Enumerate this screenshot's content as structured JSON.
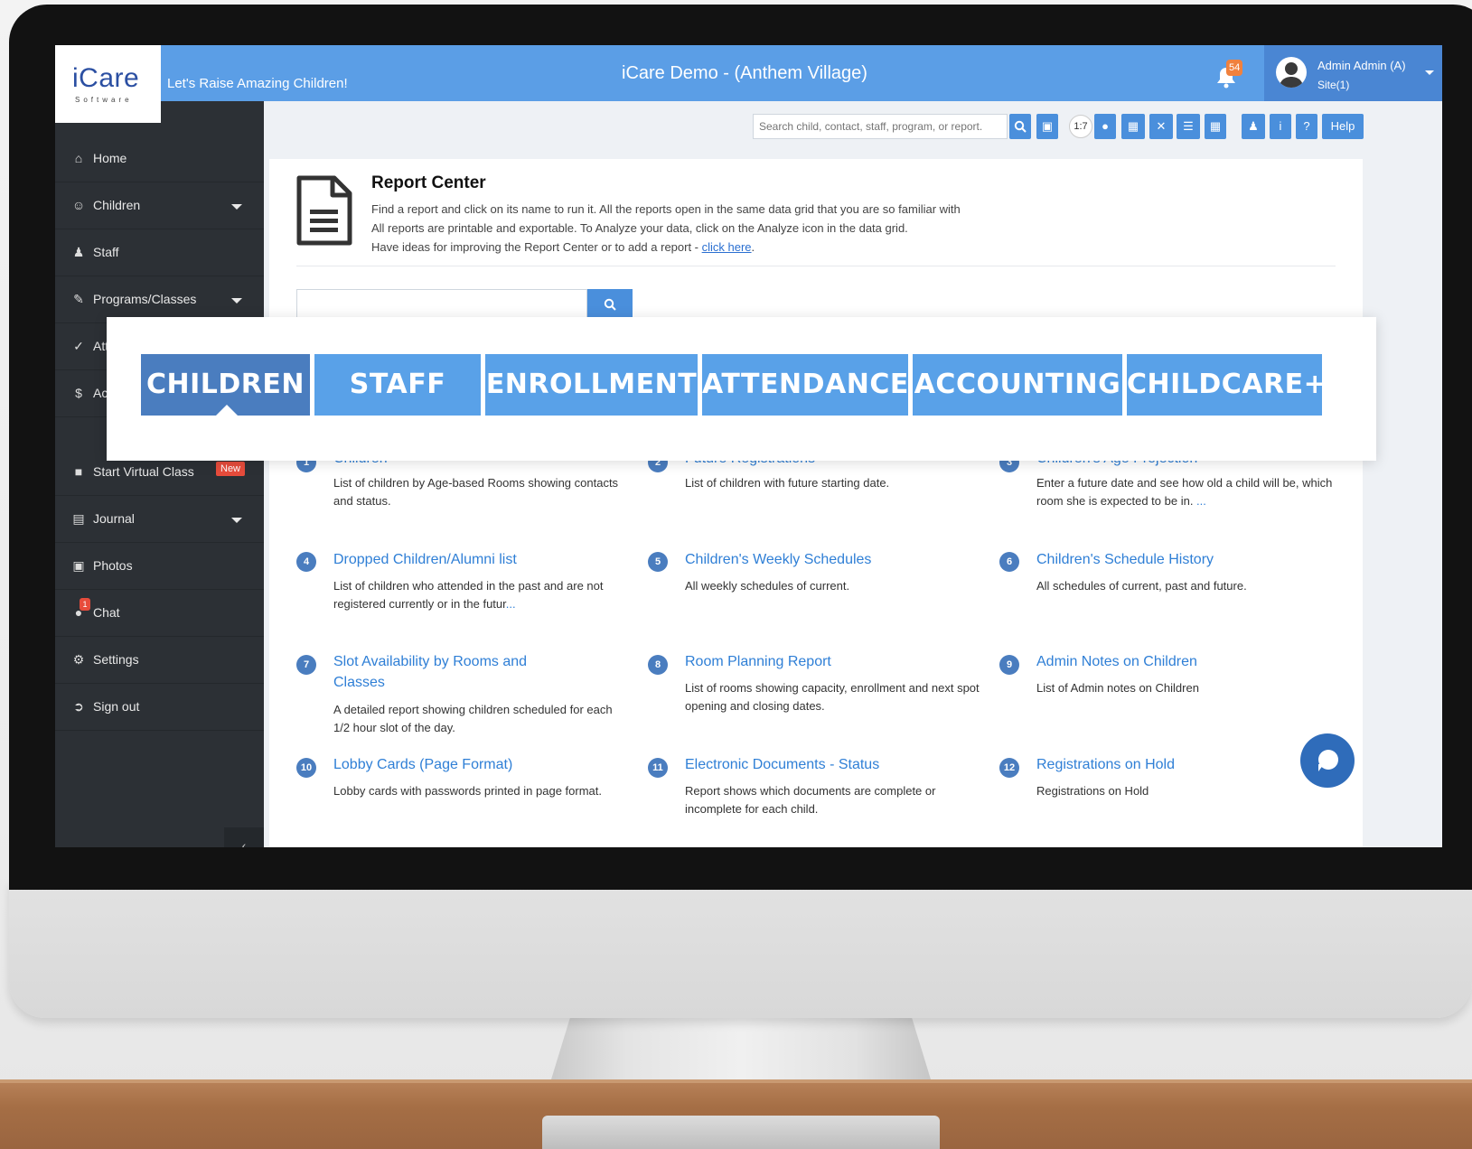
{
  "app": {
    "logo_text": "iCare",
    "logo_sub": "Software",
    "tagline": "Let's Raise Amazing Children!",
    "title": "iCare Demo - (Anthem Village)",
    "notification_count": "54",
    "user_name": "Admin Admin (A)",
    "user_site": "Site(1)"
  },
  "sidebar": {
    "items": [
      {
        "label": "Home",
        "icon": "home-icon"
      },
      {
        "label": "Children",
        "icon": "smile-icon"
      },
      {
        "label": "Staff",
        "icon": "user-icon"
      },
      {
        "label": "Programs/Classes",
        "icon": "pencil-icon"
      },
      {
        "label": "Att",
        "icon": "check-circle-icon"
      },
      {
        "label": "Ac",
        "icon": "dollar-icon"
      },
      {
        "label": "Start Virtual Class",
        "icon": "video-icon",
        "badge": "New"
      },
      {
        "label": "Journal",
        "icon": "chart-icon"
      },
      {
        "label": "Photos",
        "icon": "camera-icon"
      },
      {
        "label": "Chat",
        "icon": "chat-icon",
        "badge": "1"
      },
      {
        "label": "Settings",
        "icon": "gear-icon"
      },
      {
        "label": "Sign out",
        "icon": "sign-out-icon"
      }
    ],
    "collapse_label": "‹"
  },
  "toolbar": {
    "search_placeholder": "Search child, contact, staff, program, or report.",
    "ratio_label": "1:7",
    "info_label": "i",
    "question_label": "?",
    "help_label": "Help"
  },
  "report_center": {
    "title": "Report Center",
    "line1": "Find a report and click on its name to run it. All the reports open in the same data grid that you are so familiar with",
    "line2": "All reports are printable and exportable. To Analyze your data, click on the Analyze icon in the data grid.",
    "line3": "Have ideas for improving the Report Center or to add a report - ",
    "link_text": "click here",
    "link_suffix": "."
  },
  "categories": [
    "CHILDREN",
    "STAFF",
    "ENROLLMENT",
    "ATTENDANCE",
    "ACCOUNTING",
    "CHILDCARE+"
  ],
  "reports": [
    {
      "num": "1",
      "title": "Children",
      "desc": "List of children by Age-based Rooms showing contacts and status."
    },
    {
      "num": "2",
      "title": "Future Registrations",
      "desc": "List of children with future starting date."
    },
    {
      "num": "3",
      "title": "Children's Age Projection",
      "desc": "Enter a future date and see how old a child will be, which room she is expected to be in.",
      "more": " ..."
    },
    {
      "num": "4",
      "title": "Dropped Children/Alumni list",
      "desc": "List of children who attended in the past and are not registered currently or in the futur",
      "more": "..."
    },
    {
      "num": "5",
      "title": "Children's Weekly Schedules",
      "desc": "All weekly schedules of current."
    },
    {
      "num": "6",
      "title": "Children's Schedule History",
      "desc": "All schedules of current, past and future."
    },
    {
      "num": "7",
      "title": "Slot Availability by Rooms and Classes",
      "desc": "A detailed report showing children scheduled for each 1/2 hour slot of the day."
    },
    {
      "num": "8",
      "title": "Room Planning Report",
      "desc": "List of rooms showing capacity, enrollment and next spot opening and closing dates."
    },
    {
      "num": "9",
      "title": "Admin Notes on Children",
      "desc": "List of Admin notes on Children"
    },
    {
      "num": "10",
      "title": "Lobby Cards (Page Format)",
      "desc": "Lobby cards with passwords printed in page format."
    },
    {
      "num": "11",
      "title": "Electronic Documents - Status",
      "desc": "Report shows which documents are complete or incomplete for each child."
    },
    {
      "num": "12",
      "title": "Registrations on Hold",
      "desc": "Registrations on Hold"
    }
  ],
  "colors": {
    "topbar": "#5b9ee6",
    "sidebar": "#2c3035",
    "tab": "#59a1e8",
    "tab_active": "#4a7dbf",
    "link": "#2f7fd6"
  }
}
